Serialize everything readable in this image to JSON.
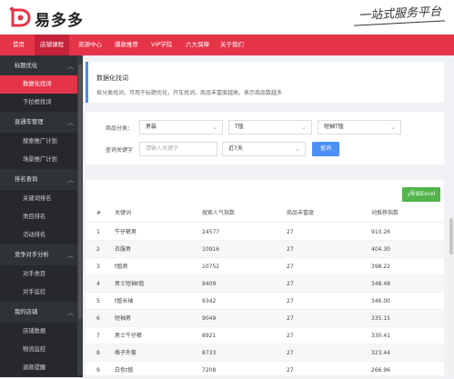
{
  "brand": {
    "name": "易多多",
    "slogan": "一站式服务平台",
    "accent": "#e53448"
  },
  "nav": [
    "首页",
    "店铺课程",
    "资源中心",
    "爆款推荐",
    "VIP学院",
    "六大保障",
    "关于我们"
  ],
  "sidebar": {
    "groups": [
      {
        "label": "标题优化",
        "items": [
          "数据化找词",
          "下拉框找词"
        ]
      },
      {
        "label": "直通车管理",
        "items": [
          "搜索推广计划",
          "场景推广计划"
        ]
      },
      {
        "label": "排名查询",
        "items": [
          "关键词排名",
          "类目排名",
          "活动排名"
        ]
      },
      {
        "label": "竞争对手分析",
        "items": [
          "对手类目",
          "对手监控"
        ]
      },
      {
        "label": "我的店铺",
        "items": [
          "店铺数据",
          "物流监控",
          "退款提醒"
        ]
      }
    ],
    "active": "数据化找词"
  },
  "page": {
    "title": "数据化找词",
    "description": "按分类找词，可用于标题优化，开车找词，商品丰富度越高，表示商品数越多"
  },
  "filters": {
    "category_label": "商品分类：",
    "category_values": [
      "男装",
      "T恤",
      "短袖T恤"
    ],
    "keyword_label": "查询关键字",
    "keyword_placeholder": "请输入关键字",
    "period_value": "近7天",
    "query_button": "查询"
  },
  "export_button": "导出Excel",
  "table": {
    "headers": [
      "#",
      "关键词",
      "搜索人气指数",
      "商品丰富度",
      "词推荐指数"
    ],
    "rows": [
      [
        "1",
        "牛仔裤男",
        "24577",
        "27",
        "910.26"
      ],
      [
        "2",
        "衣服男",
        "10916",
        "27",
        "404.30"
      ],
      [
        "3",
        "t恤男",
        "10752",
        "27",
        "398.22"
      ],
      [
        "4",
        "男士短袖t恤",
        "9409",
        "27",
        "348.48"
      ],
      [
        "5",
        "t恤长袖",
        "9342",
        "27",
        "346.00"
      ],
      [
        "6",
        "短袖男",
        "9049",
        "27",
        "335.15"
      ],
      [
        "7",
        "男士牛仔裤",
        "8921",
        "27",
        "330.41"
      ],
      [
        "8",
        "格子外套",
        "8733",
        "27",
        "323.44"
      ],
      [
        "9",
        "白色t恤",
        "7208",
        "27",
        "266.96"
      ]
    ]
  }
}
